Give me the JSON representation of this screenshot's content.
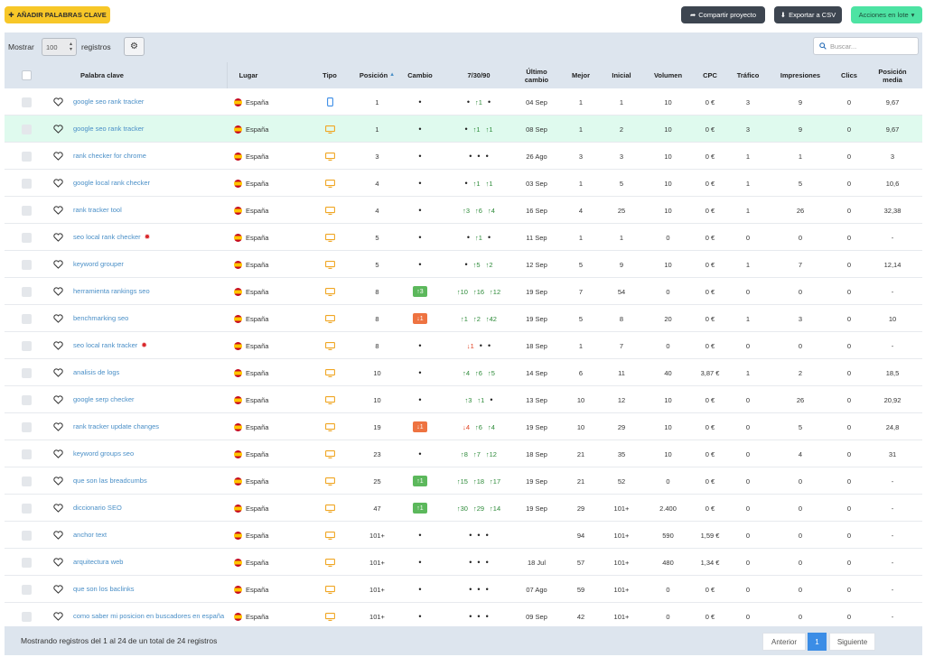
{
  "toolbar": {
    "add_keywords": "AÑADIR PALABRAS CLAVE",
    "share": "Compartir proyecto",
    "export": "Exportar a CSV",
    "bulk": "Acciones en lote"
  },
  "controls": {
    "show_label": "Mostrar",
    "show_value": "100",
    "records_label": "registros",
    "search_placeholder": "Buscar..."
  },
  "columns": {
    "keyword": "Palabra clave",
    "place": "Lugar",
    "type": "Tipo",
    "position": "Posición",
    "change": "Cambio",
    "trend": "7/30/90",
    "last_change": "Último cambio",
    "best": "Mejor",
    "initial": "Inicial",
    "volume": "Volumen",
    "cpc": "CPC",
    "traffic": "Tráfico",
    "impressions": "Impresiones",
    "clicks": "Clics",
    "avg_position": "Posición media"
  },
  "rows": [
    {
      "kw": "google seo rank tracker",
      "place": "España",
      "type": "mobile",
      "pos": "1",
      "change": "",
      "change_dir": "",
      "t7": "•",
      "t30": "↑1",
      "t90": "•",
      "last": "04 Sep",
      "best": "1",
      "initial": "1",
      "volume": "10",
      "cpc": "0 €",
      "traffic": "3",
      "impr": "9",
      "clicks": "0",
      "avg": "9,67",
      "bug": false,
      "hl": false
    },
    {
      "kw": "google seo rank tracker",
      "place": "España",
      "type": "desktop",
      "pos": "1",
      "change": "",
      "change_dir": "",
      "t7": "•",
      "t30": "↑1",
      "t90": "↑1",
      "last": "08 Sep",
      "best": "1",
      "initial": "2",
      "volume": "10",
      "cpc": "0 €",
      "traffic": "3",
      "impr": "9",
      "clicks": "0",
      "avg": "9,67",
      "bug": false,
      "hl": true
    },
    {
      "kw": "rank checker for chrome",
      "place": "España",
      "type": "desktop",
      "pos": "3",
      "change": "",
      "change_dir": "",
      "t7": "•",
      "t30": "•",
      "t90": "•",
      "last": "26 Ago",
      "best": "3",
      "initial": "3",
      "volume": "10",
      "cpc": "0 €",
      "traffic": "1",
      "impr": "1",
      "clicks": "0",
      "avg": "3",
      "bug": false,
      "hl": false
    },
    {
      "kw": "google local rank checker",
      "place": "España",
      "type": "desktop",
      "pos": "4",
      "change": "",
      "change_dir": "",
      "t7": "•",
      "t30": "↑1",
      "t90": "↑1",
      "last": "03 Sep",
      "best": "1",
      "initial": "5",
      "volume": "10",
      "cpc": "0 €",
      "traffic": "1",
      "impr": "5",
      "clicks": "0",
      "avg": "10,6",
      "bug": false,
      "hl": false
    },
    {
      "kw": "rank tracker tool",
      "place": "España",
      "type": "desktop",
      "pos": "4",
      "change": "",
      "change_dir": "",
      "t7": "↑3",
      "t30": "↑6",
      "t90": "↑4",
      "last": "16 Sep",
      "best": "4",
      "initial": "25",
      "volume": "10",
      "cpc": "0 €",
      "traffic": "1",
      "impr": "26",
      "clicks": "0",
      "avg": "32,38",
      "bug": false,
      "hl": false
    },
    {
      "kw": "seo local rank checker",
      "place": "España",
      "type": "desktop",
      "pos": "5",
      "change": "",
      "change_dir": "",
      "t7": "•",
      "t30": "↑1",
      "t90": "•",
      "last": "11 Sep",
      "best": "1",
      "initial": "1",
      "volume": "0",
      "cpc": "0 €",
      "traffic": "0",
      "impr": "0",
      "clicks": "0",
      "avg": "-",
      "bug": true,
      "hl": false
    },
    {
      "kw": "keyword grouper",
      "place": "España",
      "type": "desktop",
      "pos": "5",
      "change": "",
      "change_dir": "",
      "t7": "•",
      "t30": "↑5",
      "t90": "↑2",
      "last": "12 Sep",
      "best": "5",
      "initial": "9",
      "volume": "10",
      "cpc": "0 €",
      "traffic": "1",
      "impr": "7",
      "clicks": "0",
      "avg": "12,14",
      "bug": false,
      "hl": false
    },
    {
      "kw": "herramienta rankings seo",
      "place": "España",
      "type": "desktop",
      "pos": "8",
      "change": "↑3",
      "change_dir": "up",
      "t7": "↑10",
      "t30": "↑16",
      "t90": "↑12",
      "last": "19 Sep",
      "best": "7",
      "initial": "54",
      "volume": "0",
      "cpc": "0 €",
      "traffic": "0",
      "impr": "0",
      "clicks": "0",
      "avg": "-",
      "bug": false,
      "hl": false
    },
    {
      "kw": "benchmarking seo",
      "place": "España",
      "type": "desktop",
      "pos": "8",
      "change": "↓1",
      "change_dir": "down",
      "t7": "↑1",
      "t30": "↑2",
      "t90": "↑42",
      "last": "19 Sep",
      "best": "5",
      "initial": "8",
      "volume": "20",
      "cpc": "0 €",
      "traffic": "1",
      "impr": "3",
      "clicks": "0",
      "avg": "10",
      "bug": false,
      "hl": false
    },
    {
      "kw": "seo local rank tracker",
      "place": "España",
      "type": "desktop",
      "pos": "8",
      "change": "",
      "change_dir": "",
      "t7": "↓1",
      "t30": "•",
      "t90": "•",
      "last": "18 Sep",
      "best": "1",
      "initial": "7",
      "volume": "0",
      "cpc": "0 €",
      "traffic": "0",
      "impr": "0",
      "clicks": "0",
      "avg": "-",
      "bug": true,
      "hl": false
    },
    {
      "kw": "analisis de logs",
      "place": "España",
      "type": "desktop",
      "pos": "10",
      "change": "",
      "change_dir": "",
      "t7": "↑4",
      "t30": "↑6",
      "t90": "↑5",
      "last": "14 Sep",
      "best": "6",
      "initial": "11",
      "volume": "40",
      "cpc": "3,87 €",
      "traffic": "1",
      "impr": "2",
      "clicks": "0",
      "avg": "18,5",
      "bug": false,
      "hl": false
    },
    {
      "kw": "google serp checker",
      "place": "España",
      "type": "desktop",
      "pos": "10",
      "change": "",
      "change_dir": "",
      "t7": "↑3",
      "t30": "↑1",
      "t90": "•",
      "last": "13 Sep",
      "best": "10",
      "initial": "12",
      "volume": "10",
      "cpc": "0 €",
      "traffic": "0",
      "impr": "26",
      "clicks": "0",
      "avg": "20,92",
      "bug": false,
      "hl": false
    },
    {
      "kw": "rank tracker update changes",
      "place": "España",
      "type": "desktop",
      "pos": "19",
      "change": "↓1",
      "change_dir": "down",
      "t7": "↓4",
      "t30": "↑6",
      "t90": "↑4",
      "last": "19 Sep",
      "best": "10",
      "initial": "29",
      "volume": "10",
      "cpc": "0 €",
      "traffic": "0",
      "impr": "5",
      "clicks": "0",
      "avg": "24,8",
      "bug": false,
      "hl": false
    },
    {
      "kw": "keyword groups seo",
      "place": "España",
      "type": "desktop",
      "pos": "23",
      "change": "",
      "change_dir": "",
      "t7": "↑8",
      "t30": "↑7",
      "t90": "↑12",
      "last": "18 Sep",
      "best": "21",
      "initial": "35",
      "volume": "10",
      "cpc": "0 €",
      "traffic": "0",
      "impr": "4",
      "clicks": "0",
      "avg": "31",
      "bug": false,
      "hl": false
    },
    {
      "kw": "que son las breadcumbs",
      "place": "España",
      "type": "desktop",
      "pos": "25",
      "change": "↑1",
      "change_dir": "up",
      "t7": "↑15",
      "t30": "↑18",
      "t90": "↑17",
      "last": "19 Sep",
      "best": "21",
      "initial": "52",
      "volume": "0",
      "cpc": "0 €",
      "traffic": "0",
      "impr": "0",
      "clicks": "0",
      "avg": "-",
      "bug": false,
      "hl": false
    },
    {
      "kw": "diccionario SEO",
      "place": "España",
      "type": "desktop",
      "pos": "47",
      "change": "↑1",
      "change_dir": "up",
      "t7": "↑30",
      "t30": "↑29",
      "t90": "↑14",
      "last": "19 Sep",
      "best": "29",
      "initial": "101+",
      "volume": "2.400",
      "cpc": "0 €",
      "traffic": "0",
      "impr": "0",
      "clicks": "0",
      "avg": "-",
      "bug": false,
      "hl": false
    },
    {
      "kw": "anchor text",
      "place": "España",
      "type": "desktop",
      "pos": "101+",
      "change": "",
      "change_dir": "",
      "t7": "•",
      "t30": "•",
      "t90": "•",
      "last": "",
      "best": "94",
      "initial": "101+",
      "volume": "590",
      "cpc": "1,59 €",
      "traffic": "0",
      "impr": "0",
      "clicks": "0",
      "avg": "-",
      "bug": false,
      "hl": false
    },
    {
      "kw": "arquitectura web",
      "place": "España",
      "type": "desktop",
      "pos": "101+",
      "change": "",
      "change_dir": "",
      "t7": "•",
      "t30": "•",
      "t90": "•",
      "last": "18 Jul",
      "best": "57",
      "initial": "101+",
      "volume": "480",
      "cpc": "1,34 €",
      "traffic": "0",
      "impr": "0",
      "clicks": "0",
      "avg": "-",
      "bug": false,
      "hl": false
    },
    {
      "kw": "que son los baclinks",
      "place": "España",
      "type": "desktop",
      "pos": "101+",
      "change": "",
      "change_dir": "",
      "t7": "•",
      "t30": "•",
      "t90": "•",
      "last": "07 Ago",
      "best": "59",
      "initial": "101+",
      "volume": "0",
      "cpc": "0 €",
      "traffic": "0",
      "impr": "0",
      "clicks": "0",
      "avg": "-",
      "bug": false,
      "hl": false
    },
    {
      "kw": "como saber mi posicion en buscadores en españa",
      "place": "España",
      "type": "desktop",
      "pos": "101+",
      "change": "",
      "change_dir": "",
      "t7": "•",
      "t30": "•",
      "t90": "•",
      "last": "09 Sep",
      "best": "42",
      "initial": "101+",
      "volume": "0",
      "cpc": "0 €",
      "traffic": "0",
      "impr": "0",
      "clicks": "0",
      "avg": "-",
      "bug": false,
      "hl": false
    }
  ],
  "footer": {
    "info": "Mostrando registros del 1 al 24 de un total de 24 registros",
    "prev": "Anterior",
    "page": "1",
    "next": "Siguiente"
  }
}
